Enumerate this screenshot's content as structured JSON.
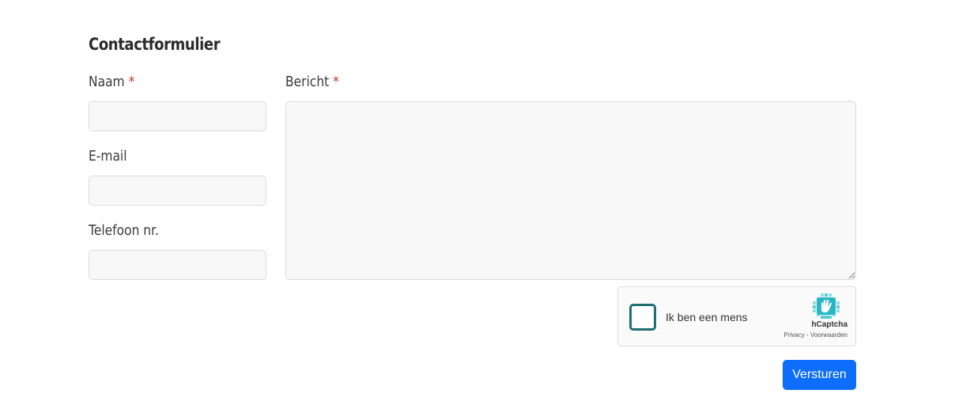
{
  "form": {
    "title": "Contactformulier",
    "required_marker": "*",
    "name_label": "Naam",
    "name_value": "",
    "email_label": "E-mail",
    "email_value": "",
    "phone_label": "Telefoon nr.",
    "phone_value": "",
    "message_label": "Bericht",
    "message_value": "",
    "submit_label": "Versturen"
  },
  "captcha": {
    "checkbox_label": "Ik ben een mens",
    "brand": "hCaptcha",
    "privacy_link": "Privacy",
    "separator": " - ",
    "terms_link": "Voorwaarden",
    "checked": false
  },
  "colors": {
    "primary_button": "#0d6efd",
    "required_star": "#c0392b",
    "captcha_checkbox_border": "#1f6f72",
    "captcha_logo": "#27b6c4"
  },
  "icons": [
    "hcaptcha-logo-icon",
    "resize-grip-icon"
  ]
}
